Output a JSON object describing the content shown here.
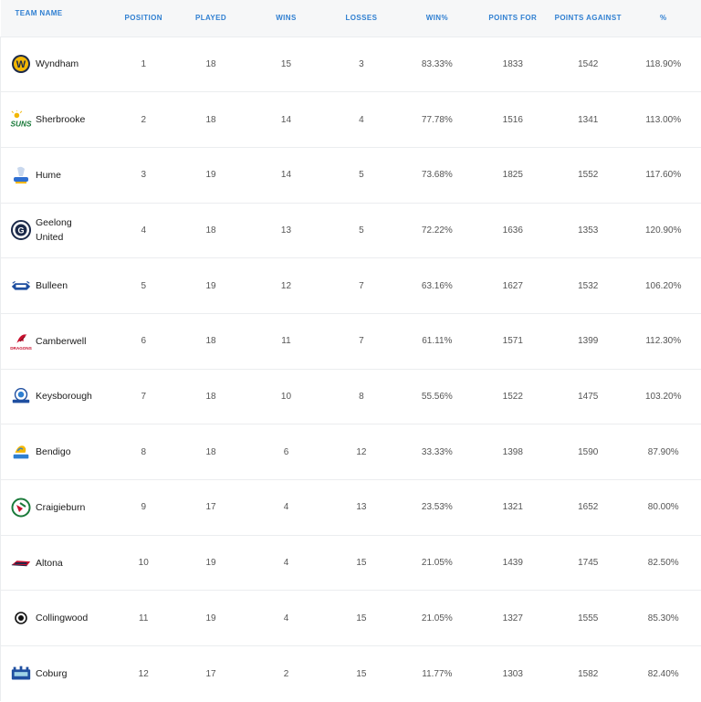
{
  "headers": {
    "team": "TEAM NAME",
    "position": "POSITION",
    "played": "PLAYED",
    "wins": "WINS",
    "losses": "LOSSES",
    "win_pct": "WIN%",
    "points_for": "POINTS FOR",
    "points_against": "POINTS AGAINST",
    "pct": "%"
  },
  "rows": [
    {
      "team": "Wyndham",
      "logo": "wyndham-logo",
      "position": "1",
      "played": "18",
      "wins": "15",
      "losses": "3",
      "win_pct": "83.33%",
      "points_for": "1833",
      "points_against": "1542",
      "pct": "118.90%"
    },
    {
      "team": "Sherbrooke",
      "logo": "sherbrooke-logo",
      "position": "2",
      "played": "18",
      "wins": "14",
      "losses": "4",
      "win_pct": "77.78%",
      "points_for": "1516",
      "points_against": "1341",
      "pct": "113.00%"
    },
    {
      "team": "Hume",
      "logo": "hume-logo",
      "position": "3",
      "played": "19",
      "wins": "14",
      "losses": "5",
      "win_pct": "73.68%",
      "points_for": "1825",
      "points_against": "1552",
      "pct": "117.60%"
    },
    {
      "team": "Geelong United",
      "logo": "geelong-logo",
      "position": "4",
      "played": "18",
      "wins": "13",
      "losses": "5",
      "win_pct": "72.22%",
      "points_for": "1636",
      "points_against": "1353",
      "pct": "120.90%"
    },
    {
      "team": "Bulleen",
      "logo": "bulleen-logo",
      "position": "5",
      "played": "19",
      "wins": "12",
      "losses": "7",
      "win_pct": "63.16%",
      "points_for": "1627",
      "points_against": "1532",
      "pct": "106.20%"
    },
    {
      "team": "Camberwell",
      "logo": "camberwell-logo",
      "position": "6",
      "played": "18",
      "wins": "11",
      "losses": "7",
      "win_pct": "61.11%",
      "points_for": "1571",
      "points_against": "1399",
      "pct": "112.30%"
    },
    {
      "team": "Keysborough",
      "logo": "keysborough-logo",
      "position": "7",
      "played": "18",
      "wins": "10",
      "losses": "8",
      "win_pct": "55.56%",
      "points_for": "1522",
      "points_against": "1475",
      "pct": "103.20%"
    },
    {
      "team": "Bendigo",
      "logo": "bendigo-logo",
      "position": "8",
      "played": "18",
      "wins": "6",
      "losses": "12",
      "win_pct": "33.33%",
      "points_for": "1398",
      "points_against": "1590",
      "pct": "87.90%"
    },
    {
      "team": "Craigieburn",
      "logo": "craigieburn-logo",
      "position": "9",
      "played": "17",
      "wins": "4",
      "losses": "13",
      "win_pct": "23.53%",
      "points_for": "1321",
      "points_against": "1652",
      "pct": "80.00%"
    },
    {
      "team": "Altona",
      "logo": "altona-logo",
      "position": "10",
      "played": "19",
      "wins": "4",
      "losses": "15",
      "win_pct": "21.05%",
      "points_for": "1439",
      "points_against": "1745",
      "pct": "82.50%"
    },
    {
      "team": "Collingwood",
      "logo": "collingwood-logo",
      "position": "11",
      "played": "19",
      "wins": "4",
      "losses": "15",
      "win_pct": "21.05%",
      "points_for": "1327",
      "points_against": "1555",
      "pct": "85.30%"
    },
    {
      "team": "Coburg",
      "logo": "coburg-logo",
      "position": "12",
      "played": "17",
      "wins": "2",
      "losses": "15",
      "win_pct": "11.77%",
      "points_for": "1303",
      "points_against": "1582",
      "pct": "82.40%"
    }
  ]
}
